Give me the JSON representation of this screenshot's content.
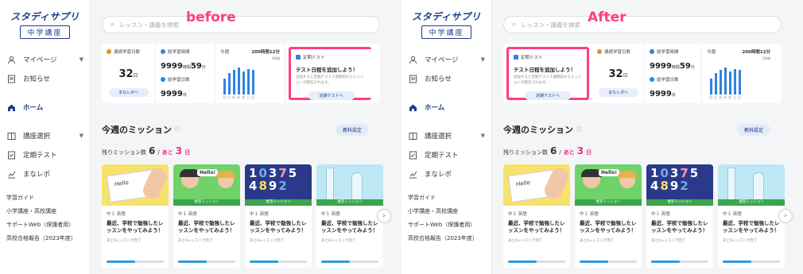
{
  "brand": {
    "name": "スタディサプリ",
    "sub": "中学講座"
  },
  "search": {
    "placeholder": "レッスン・講義を検索"
  },
  "nav": [
    {
      "label": "マイページ",
      "icon": "user-icon"
    },
    {
      "label": "お知らせ",
      "icon": "notice-icon"
    },
    {
      "label": "ホーム",
      "icon": "home-icon"
    },
    {
      "label": "講座選択",
      "icon": "course-icon"
    },
    {
      "label": "定期テスト",
      "icon": "test-icon"
    },
    {
      "label": "まなレポ",
      "icon": "report-icon"
    }
  ],
  "links": [
    "学習ガイド",
    "小学講座・高校講座",
    "サポートWeb（保護者用）",
    "高校合格報告（2023年度）"
  ],
  "panels": {
    "before": {
      "tag": "before"
    },
    "after": {
      "tag": "After"
    }
  },
  "stats": {
    "continuous_label": "連続学習日数",
    "continuous_value": "32",
    "continuous_unit": "日",
    "manareport_btn": "まなレポへ",
    "total_time_label": "総学習時間",
    "total_time_value": "9999",
    "total_time_h": "時間",
    "total_time_m_value": "59",
    "total_time_m": "分",
    "total_days_label": "総学習日数",
    "total_days_value": "9999",
    "total_days_unit": "日",
    "week_label": "今週",
    "week_total": "200時間12分",
    "week_max": "2時間",
    "week_days": [
      "月",
      "火",
      "水",
      "木",
      "金",
      "土",
      "日"
    ],
    "week_values": [
      0.55,
      0.75,
      0.85,
      0.95,
      0.8,
      0.9,
      0.85
    ],
    "test_label": "定期テスト",
    "test_title": "テスト日程を追加しよう！",
    "test_desc": "追加すると定期テスト３週間前からミッションが配信されます。",
    "test_btn": "定期テストへ"
  },
  "mission": {
    "title": "今週のミッション",
    "settings": "教科設定",
    "remain_label": "残りミッション数",
    "remain_count": "6",
    "sep": "/",
    "days_label": "あと",
    "days_count": "3",
    "days_unit": "日",
    "cards": [
      {
        "sub": "中１ 英語",
        "title": "最近、学校で勉強したレッスンをやってみよう！",
        "rest": "あと6レッスンで完了",
        "ribbon": "",
        "progress": 0.5
      },
      {
        "sub": "中１ 英語",
        "title": "最近、学校で勉強したレッスンをやってみよう！",
        "rest": "あと6レッスンで完了",
        "ribbon": "復習ミッション",
        "progress": 0.5
      },
      {
        "sub": "中１ 英語",
        "title": "最近、学校で勉強したレッスンをやってみよう！",
        "rest": "あと6レッスンで完了",
        "ribbon": "復習ミッション",
        "progress": 0.5
      },
      {
        "sub": "中１ 英語",
        "title": "最近、学校で勉強したレッスンをやってみよう！",
        "rest": "あと6レッスンで完了",
        "ribbon": "復習ミッション",
        "progress": 0.5
      }
    ]
  },
  "colors": {
    "accent": "#1e3c8c",
    "pink": "#ff3f7f",
    "bar": "#2e84e0"
  }
}
